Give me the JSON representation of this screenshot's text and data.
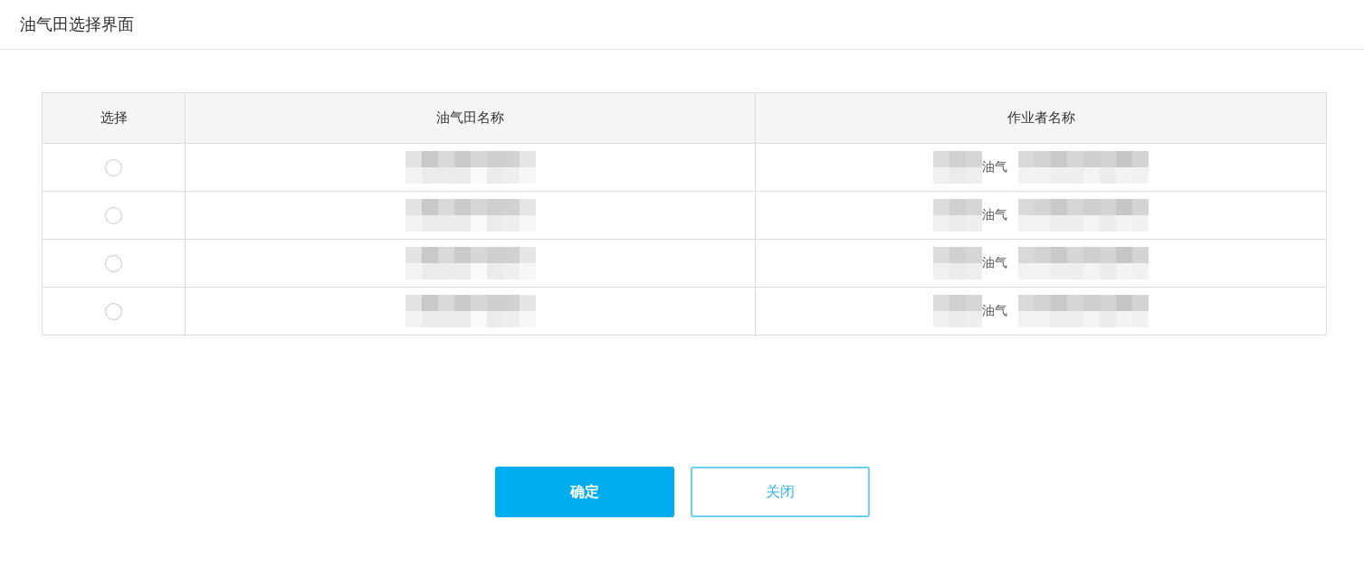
{
  "dialog": {
    "title": "油气田选择界面"
  },
  "table": {
    "columns": [
      "选择",
      "油气田名称",
      "作业者名称"
    ],
    "rows": [
      {
        "selected": false,
        "name_redacted": true,
        "operator_name": "油气",
        "operator_redacted": true
      },
      {
        "selected": false,
        "name_redacted": true,
        "operator_name": "油气",
        "operator_redacted": true
      },
      {
        "selected": false,
        "name_redacted": true,
        "operator_name": "油气",
        "operator_redacted": true
      },
      {
        "selected": false,
        "name_redacted": true,
        "operator_name": "油气",
        "operator_redacted": true
      }
    ]
  },
  "buttons": [
    {
      "label": "确定",
      "kind": "primary"
    },
    {
      "label": "关闭",
      "kind": "secondary"
    }
  ]
}
